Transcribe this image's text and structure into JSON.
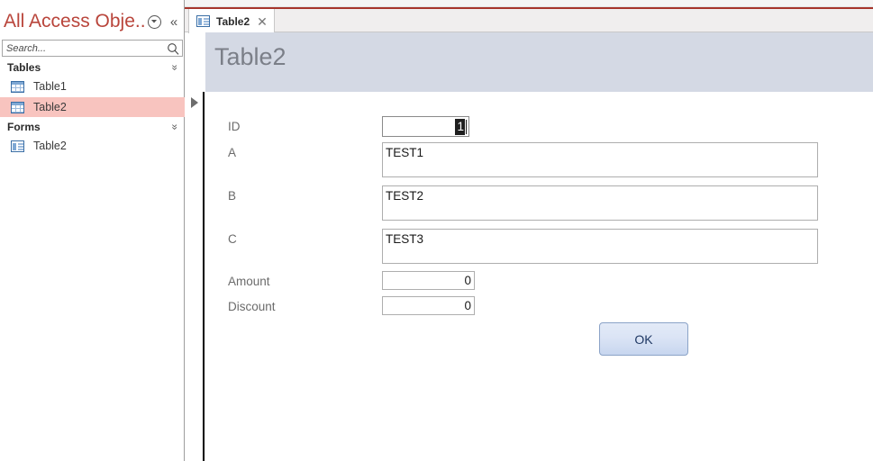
{
  "window": {
    "ribbon_ghost_text": ""
  },
  "navpane": {
    "title": "All Access Obje...",
    "dropdown_icon": "chevron-down-circle-icon",
    "collapse_icon": "double-chevron-left-icon",
    "search": {
      "value": "",
      "placeholder": "Search...",
      "icon": "search-icon"
    },
    "groups": [
      {
        "label": "Tables",
        "collapse_icon": "double-chevron-up-icon",
        "items": [
          {
            "label": "Table1",
            "icon": "table-icon",
            "selected": false
          },
          {
            "label": "Table2",
            "icon": "table-icon",
            "selected": true
          }
        ]
      },
      {
        "label": "Forms",
        "collapse_icon": "double-chevron-up-icon",
        "items": [
          {
            "label": "Table2",
            "icon": "form-icon",
            "selected": false
          }
        ]
      }
    ],
    "selection_color": "#f8c4bf",
    "title_color": "#b9453b"
  },
  "tabstrip": {
    "tabs": [
      {
        "label": "Table2",
        "icon": "form-icon",
        "close_icon": "close-icon",
        "active": true
      }
    ],
    "accent_color": "#a6352c"
  },
  "form": {
    "header_title": "Table2",
    "header_color": "#d4d9e4",
    "record_selector_icon": "record-selector-arrow-icon",
    "fields": [
      {
        "name": "id",
        "label": "ID",
        "value": "1",
        "type": "number",
        "selected": true
      },
      {
        "name": "a",
        "label": "A",
        "value": "TEST1",
        "type": "memo",
        "selected": false
      },
      {
        "name": "b",
        "label": "B",
        "value": "TEST2",
        "type": "memo",
        "selected": false
      },
      {
        "name": "c",
        "label": "C",
        "value": "TEST3",
        "type": "memo",
        "selected": false
      },
      {
        "name": "amount",
        "label": "Amount",
        "value": "0",
        "type": "number",
        "selected": false
      },
      {
        "name": "discount",
        "label": "Discount",
        "value": "0",
        "type": "number",
        "selected": false
      }
    ],
    "ok_button_label": "OK",
    "ok_button_color": "#c7d6ef"
  }
}
